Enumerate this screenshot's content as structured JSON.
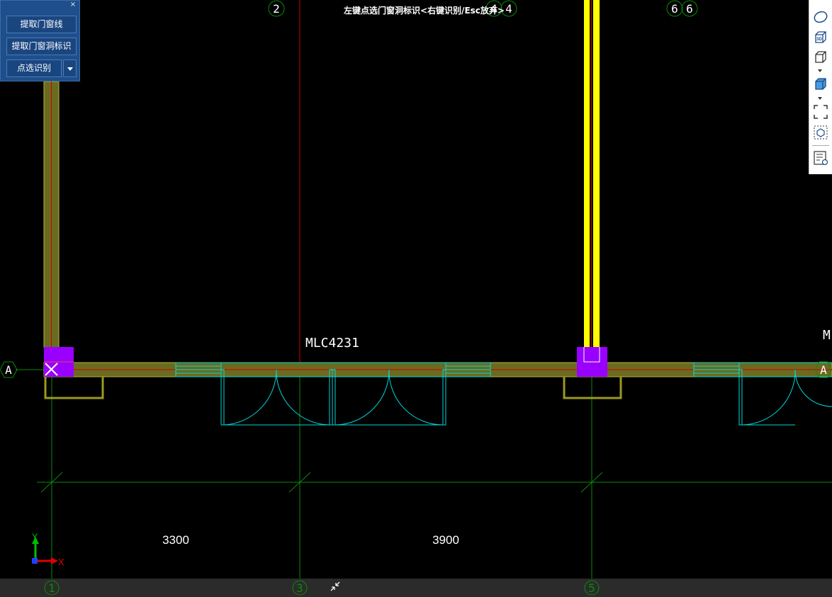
{
  "panel": {
    "close_label": "×",
    "buttons": [
      "提取门窗线",
      "提取门窗洞标识",
      "点选识别"
    ]
  },
  "axes": {
    "top": [
      "2",
      "4",
      "4",
      "6",
      "6"
    ],
    "bottom": [
      "1",
      "3",
      "5"
    ],
    "left": "A",
    "right": "A"
  },
  "annotations": {
    "window_tag": "MLC4231",
    "window_tag_right": "M",
    "dim_1": "3300",
    "dim_2": "3900"
  },
  "ucs": {
    "x_label": "X",
    "y_label": "Y"
  },
  "status": {
    "prompt": "左键点选门窗洞标识<右键识别/Esc放弃>"
  },
  "colors": {
    "background": "#000000",
    "wall": "#6b6b20",
    "column": "#9900ff",
    "selected_wall": "#ffff00",
    "door": "#00d8d8",
    "grid": "#00a000",
    "axis_red": "#d00000"
  }
}
